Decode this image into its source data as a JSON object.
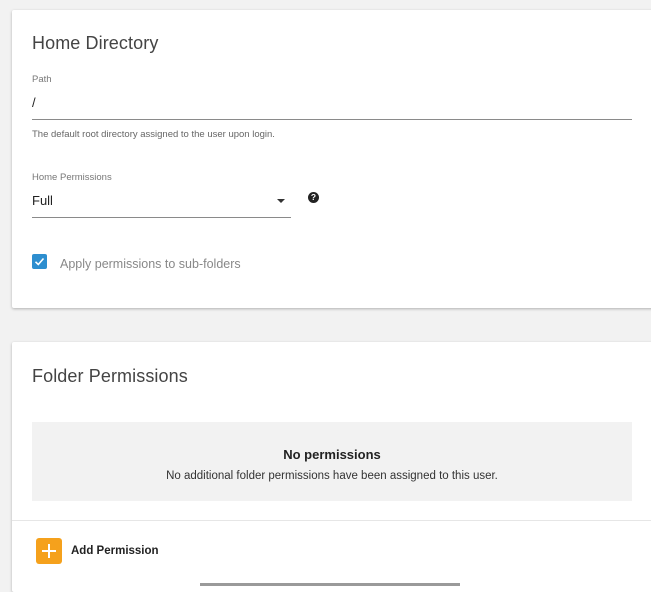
{
  "home_directory": {
    "title": "Home Directory",
    "path": {
      "label": "Path",
      "value": "/",
      "hint": "The default root directory assigned to the user upon login."
    },
    "home_permissions": {
      "label": "Home Permissions",
      "selected": "Full",
      "help_icon_glyph": "?"
    },
    "apply_subfolders": {
      "label": "Apply permissions to sub-folders",
      "checked": true
    }
  },
  "folder_permissions": {
    "title": "Folder Permissions",
    "empty_state": {
      "title": "No permissions",
      "description": "No additional folder permissions have been assigned to this user."
    },
    "add_button": {
      "label": "Add Permission",
      "icon": "plus-icon"
    }
  },
  "colors": {
    "accent_blue": "#2d8ecf",
    "add_orange": "#f5a11c"
  }
}
